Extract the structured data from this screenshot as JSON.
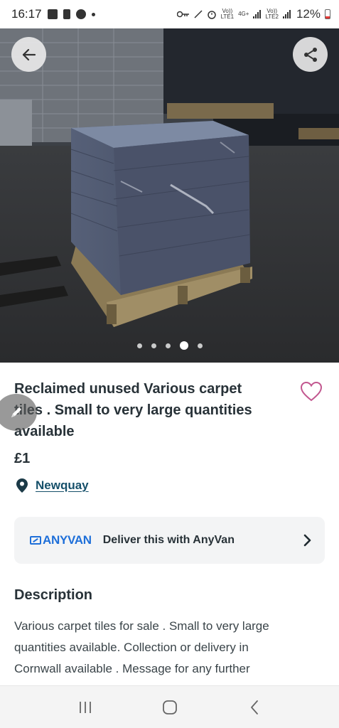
{
  "status_bar": {
    "time": "16:17",
    "battery": "12%",
    "sim1_label_top": "Vo))",
    "sim1_label_bottom": "LTE1",
    "network": "4G+",
    "sim2_label_top": "Vo))",
    "sim2_label_bottom": "LTE2"
  },
  "hero": {
    "image_description": "Pallet stacked with carpet tiles in warehouse",
    "dot_count": 5,
    "active_dot": 4,
    "back_icon": "arrow-left-icon",
    "share_icon": "share-icon"
  },
  "listing": {
    "title_line1": "Reclaimed unused Various carpet",
    "title_line2": "tiles . Small to very large quantities",
    "title_line3": "available",
    "price": "£1",
    "location": "Newquay",
    "favourite_icon": "heart-outline-icon"
  },
  "delivery": {
    "logo_text": "ANYVAN",
    "label": "Deliver this with AnyVan"
  },
  "description": {
    "heading": "Description",
    "line1": "Various carpet tiles for sale . Small to very large",
    "line2": "quantities available.  Collection or delivery in",
    "line3": "Cornwall available . Message for any further"
  },
  "colors": {
    "title": "#283238",
    "link": "#16506a",
    "heart": "#c2578f",
    "anyvan_blue": "#1e6fd9",
    "card_bg": "#f3f4f5"
  }
}
